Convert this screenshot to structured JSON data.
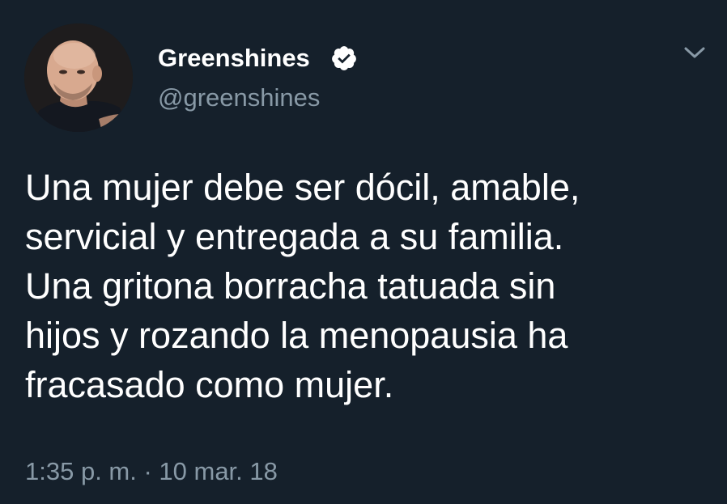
{
  "colors": {
    "background": "#15202b",
    "primary_text": "#ffffff",
    "secondary_text": "#8899a6"
  },
  "user": {
    "display_name": "Greenshines",
    "handle": "@greenshines",
    "verified": true,
    "verified_icon": "verified-badge-icon",
    "avatar": "profile-photo"
  },
  "tweet": {
    "lines": [
      "Una mujer debe ser dócil, amable,",
      "servicial y entregada a su familia.",
      "Una gritona borracha tatuada sin",
      "hijos y rozando la menopausia ha",
      "fracasado como mujer."
    ],
    "timestamp": "1:35 p. m. · 10 mar. 18"
  },
  "menu": {
    "icon": "chevron-down-icon"
  }
}
